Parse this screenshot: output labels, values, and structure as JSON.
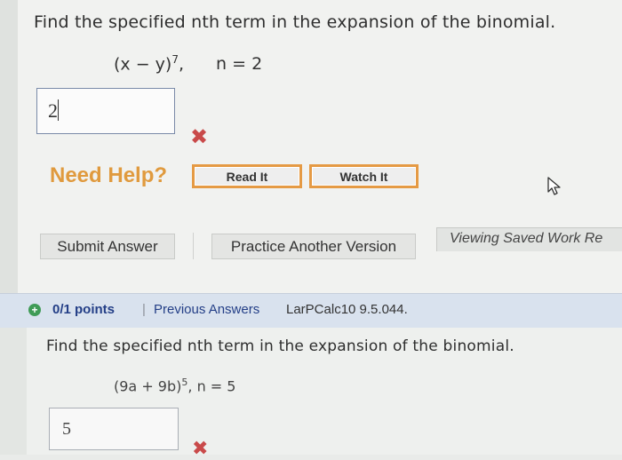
{
  "question1": {
    "prompt": "Find the specified nth term in the expansion of the binomial.",
    "expression": "(x − y)",
    "exponent": "7",
    "n_label": "n = 2",
    "answer_value": "2"
  },
  "help": {
    "label": "Need Help?",
    "read_it": "Read It",
    "watch_it": "Watch It"
  },
  "actions": {
    "submit": "Submit Answer",
    "practice": "Practice Another Version",
    "saved_work": "Viewing Saved Work Re"
  },
  "question2": {
    "points": "0/1 points",
    "separator": "|",
    "previous_answers": "Previous Answers",
    "course_code": "LarPCalc10 9.5.044.",
    "prompt": "Find the specified nth term in the expansion of the binomial.",
    "expression": "(9a + 9b)",
    "exponent": "5",
    "n_label": ", n = 5",
    "answer_value": "5"
  },
  "icons": {
    "wrong": "x-mark-icon",
    "cursor": "mouse-cursor-icon",
    "expand": "plus-circle-icon"
  },
  "colors": {
    "help_orange": "#e09a3e",
    "link_blue": "#243f87",
    "wrong_red": "#c94a4a",
    "points_green": "#3f9b56"
  }
}
